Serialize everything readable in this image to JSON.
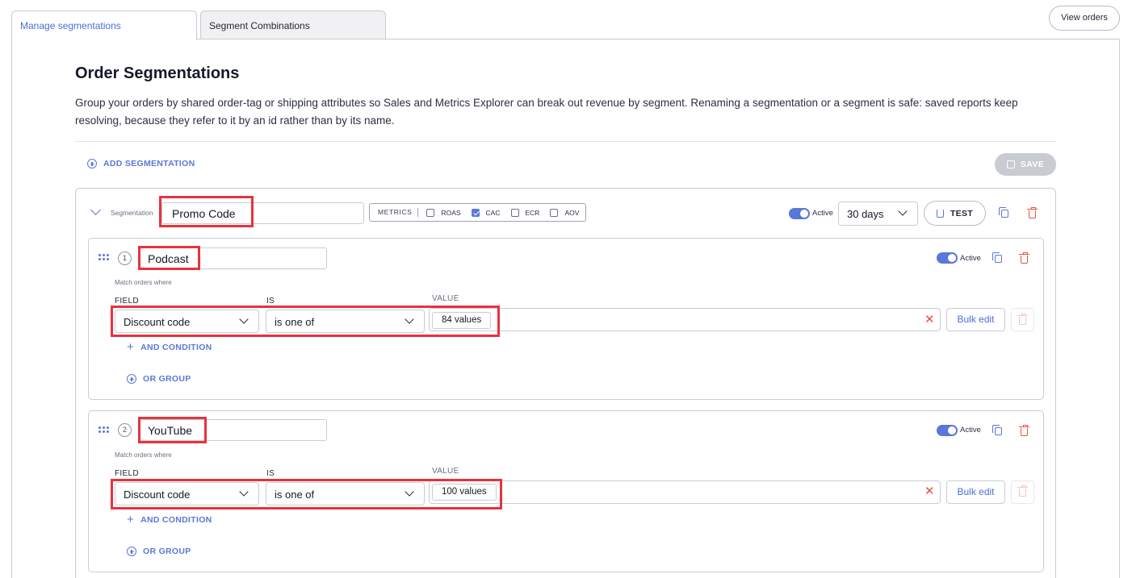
{
  "tabs": [
    {
      "label": "Manage segmentations",
      "active": true
    },
    {
      "label": "Segment Combinations",
      "active": false
    }
  ],
  "header_actions": {
    "view_orders": "View orders"
  },
  "page": {
    "title": "Order Segmentations",
    "description": "Group your orders by shared order-tag or shipping attributes so Sales and Metrics Explorer can break out revenue by segment. Renaming a segmentation or a segment is safe: saved reports keep resolving, because they refer to it by an id rather than by its name."
  },
  "toolbar": {
    "add_segmentation": "ADD SEGMENTATION",
    "save": "SAVE"
  },
  "segmentation": {
    "label": "Segmentation",
    "name": "Promo Code",
    "metrics_label": "METRICS",
    "metrics": [
      {
        "name": "ROAS",
        "checked": false
      },
      {
        "name": "CAC",
        "checked": true
      },
      {
        "name": "ECR",
        "checked": false
      },
      {
        "name": "AOV",
        "checked": false
      }
    ],
    "active_label": "Active",
    "period": "30 days",
    "test": "TEST"
  },
  "segments": [
    {
      "index": "1",
      "name": "Podcast",
      "active_label": "Active",
      "match_label": "Match orders where",
      "field_label": "FIELD",
      "is_label": "IS",
      "value_label": "VALUE",
      "field": "Discount code",
      "operator": "is one of",
      "value": "84 values",
      "bulk_edit": "Bulk edit",
      "and_condition": "AND CONDITION",
      "or_group": "OR GROUP"
    },
    {
      "index": "2",
      "name": "YouTube",
      "active_label": "Active",
      "match_label": "Match orders where",
      "field_label": "FIELD",
      "is_label": "IS",
      "value_label": "VALUE",
      "field": "Discount code",
      "operator": "is one of",
      "value": "100 values",
      "bulk_edit": "Bulk edit",
      "and_condition": "AND CONDITION",
      "or_group": "OR GROUP"
    }
  ],
  "colors": {
    "accent": "#5a78d8",
    "danger": "#e8503d",
    "highlight": "#e8323d"
  }
}
